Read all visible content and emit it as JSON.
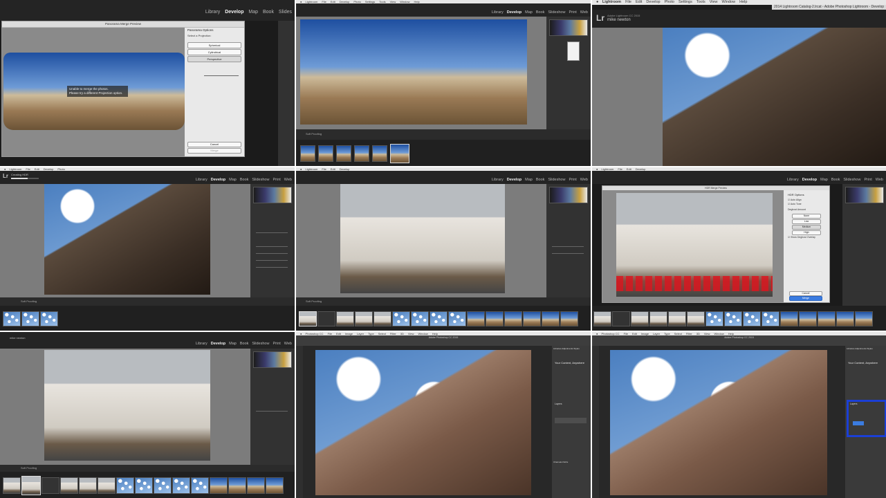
{
  "colors": {
    "accent_blue": "#3b7ce0",
    "highlight": "#1b3fd6",
    "lr_bg": "#242424",
    "ps_bg": "#3d3d3d"
  },
  "lr_menu": [
    "Lightroom",
    "File",
    "Edit",
    "Develop",
    "Photo",
    "Settings",
    "Tools",
    "View",
    "Window",
    "Help"
  ],
  "ps_menu": [
    "Photoshop CC",
    "File",
    "Edit",
    "Image",
    "Layer",
    "Type",
    "Select",
    "Filter",
    "3D",
    "View",
    "Window",
    "Help"
  ],
  "modules": [
    "Library",
    "Develop",
    "Map",
    "Book",
    "Slideshow",
    "Print",
    "Web"
  ],
  "window_title": "2014 Lightroom Catalog-2.lrcat - Adobe Photoshop Lightroom - Develop",
  "lr_logo": "Lr",
  "tiles": {
    "t1": {
      "modules": [
        "Library",
        "Develop",
        "Map",
        "Book",
        "Slides"
      ],
      "dialog_title": "Panorama Merge Preview",
      "options_title": "Panorama Options",
      "select_projection": "Select a Projection:",
      "buttons": [
        "Spherical",
        "Cylindrical",
        "Perspective"
      ],
      "error": [
        "Unable to merge the photos.",
        "Please try a different Projection option."
      ],
      "cancel": "Cancel",
      "merge": "Merge"
    },
    "t2": {
      "soft_proofing": "Soft Proofing"
    },
    "t3": {
      "title": "Adobe Lightroom CC 2015",
      "user": "mike newton"
    },
    "t4": {
      "status": "Creating HDR",
      "soft_proofing": "Soft Proofing"
    },
    "t5": {
      "soft_proofing": "Soft Proofing"
    },
    "t6": {
      "dialog_title": "HDR Merge Preview",
      "options_title": "HDR Options",
      "checks": [
        "Auto Align",
        "Auto Tone"
      ],
      "deghost_label": "Deghost Amount",
      "deghost": [
        "None",
        "Low",
        "Medium",
        "High"
      ],
      "show_overlay": "Show Deghost Overlay",
      "cancel": "Cancel",
      "merge": "Merge"
    },
    "t7": {
      "user": "mike newton",
      "soft_proofing": "Soft Proofing"
    },
    "t8": {
      "app_title": "Adobe Photoshop CC 2015",
      "panel": [
        "Libraries",
        "Adjustments",
        "Styles"
      ],
      "content_title": "Your Content, Anywhere",
      "layers_title": "Layers",
      "properties": [
        "Channels",
        "Paths"
      ]
    },
    "t9": {
      "app_title": "Adobe Photoshop CC 2015",
      "panel": [
        "Libraries",
        "Adjustments",
        "Styles"
      ],
      "content_title": "Your Content, Anywhere",
      "layers_title": "Layers"
    }
  }
}
